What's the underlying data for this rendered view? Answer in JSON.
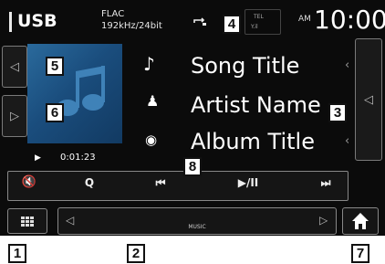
{
  "status": {
    "source": "USB",
    "codec_format": "FLAC",
    "codec_rate": "192kHz/24bit",
    "tel_top": "TEL",
    "tel_bottom": "Y.il",
    "ampm": "AM",
    "clock": "10:00"
  },
  "track": {
    "title": "Song Title",
    "artist": "Artist Name",
    "album": "Album Title",
    "elapsed": "0:01:23"
  },
  "controls": {
    "play_indicator": "▶",
    "mute": "🔇",
    "search": "Q",
    "prev": "⏮",
    "play_pause": "▶/II",
    "next": "⏭"
  },
  "list_panel": {
    "label": "MUSIC"
  },
  "callouts": [
    "1",
    "2",
    "3",
    "4",
    "5",
    "6",
    "7",
    "8"
  ]
}
